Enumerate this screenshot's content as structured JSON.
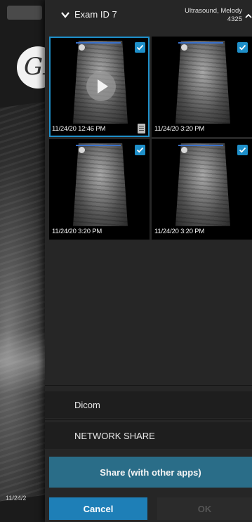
{
  "header": {
    "exam_title": "Exam ID 7",
    "patient_name": "Ultrasound, Melody",
    "patient_id": "4325"
  },
  "thumbnails": [
    {
      "timestamp": "11/24/20 12:46 PM",
      "selected": true,
      "checked": true,
      "type": "video"
    },
    {
      "timestamp": "11/24/20 3:20 PM",
      "selected": false,
      "checked": true,
      "type": "image"
    },
    {
      "timestamp": "11/24/20 3:20 PM",
      "selected": false,
      "checked": true,
      "type": "image"
    },
    {
      "timestamp": "11/24/20 3:20 PM",
      "selected": false,
      "checked": true,
      "type": "image"
    }
  ],
  "share_options": [
    {
      "label": "Dicom"
    },
    {
      "label": "NETWORK SHARE"
    }
  ],
  "buttons": {
    "share": "Share (with other apps)",
    "cancel": "Cancel",
    "ok": "OK"
  },
  "background": {
    "date_fragment": "11/24/2"
  },
  "colors": {
    "accent": "#1e8fc9",
    "share_button": "#2a6d88",
    "cancel_button": "#1e7fb7",
    "panel": "#262626"
  }
}
